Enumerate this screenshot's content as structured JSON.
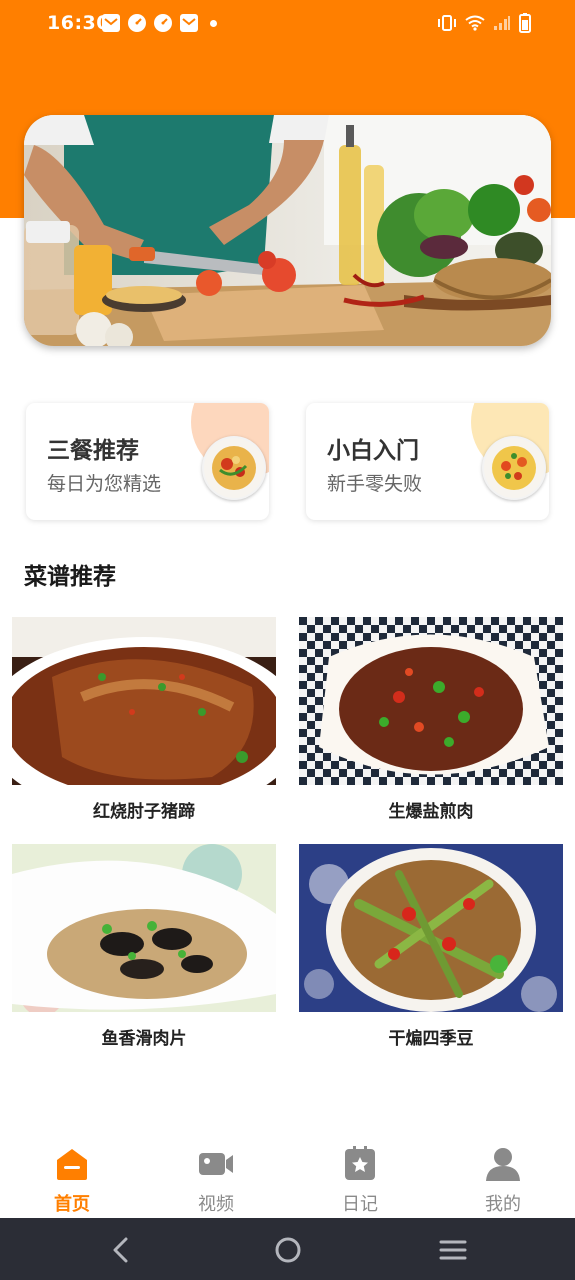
{
  "status_bar": {
    "time": "16:30",
    "icons": [
      "mail-icon",
      "speedometer-icon",
      "speedometer-icon",
      "mail-icon",
      "dot-icon",
      "vibrate-icon",
      "wifi-icon",
      "signal-icon",
      "battery-icon"
    ]
  },
  "colors": {
    "accent": "#FF7F00",
    "card_blob_1": "#FDD7BD",
    "card_blob_2": "#FDE7B5",
    "nav_bar": "#2b2d36",
    "inactive": "#8a8a8a"
  },
  "cards": [
    {
      "title": "三餐推荐",
      "subtitle": "每日为您精选"
    },
    {
      "title": "小白入门",
      "subtitle": "新手零失败"
    }
  ],
  "section": {
    "title": "菜谱推荐"
  },
  "recipes": [
    {
      "name": "红烧肘子猪蹄"
    },
    {
      "name": "生爆盐煎肉"
    },
    {
      "name": "鱼香滑肉片"
    },
    {
      "name": "干煸四季豆"
    }
  ],
  "bottom_nav": [
    {
      "label": "首页",
      "icon": "home-icon",
      "active": true
    },
    {
      "label": "视频",
      "icon": "video-camera-icon",
      "active": false
    },
    {
      "label": "日记",
      "icon": "diary-icon",
      "active": false
    },
    {
      "label": "我的",
      "icon": "profile-icon",
      "active": false
    }
  ]
}
